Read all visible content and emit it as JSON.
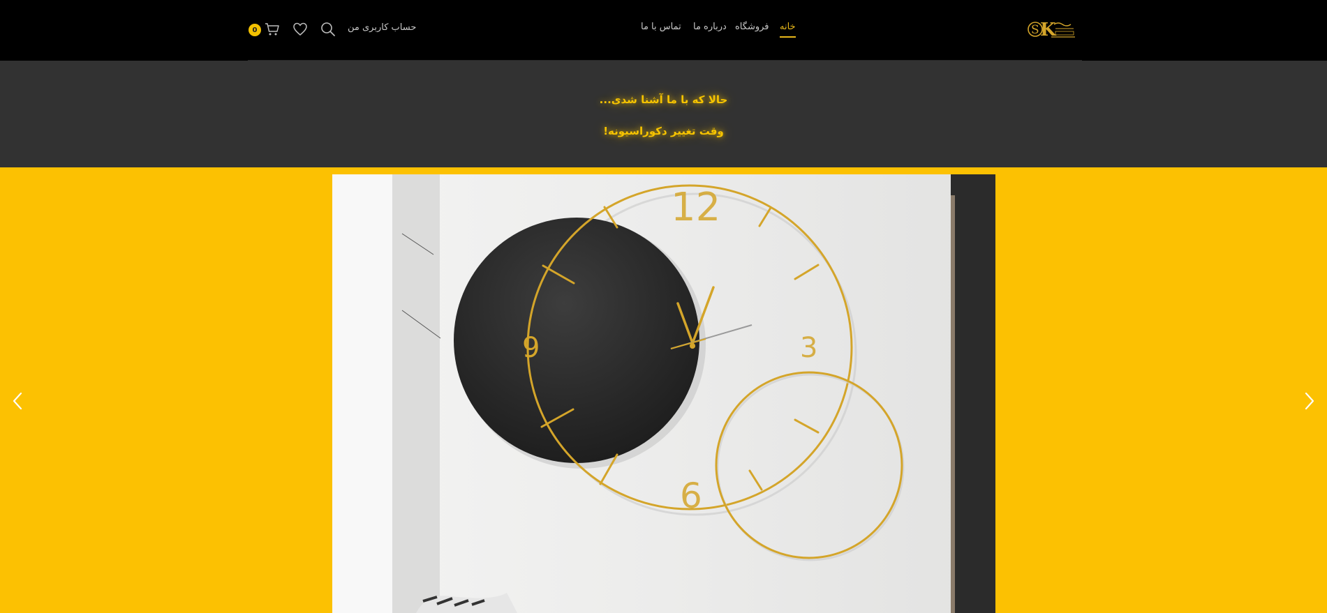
{
  "header": {
    "logo": {
      "monogram": "SK",
      "icon": "logo-icon"
    },
    "nav": [
      {
        "label": "خانه",
        "active": true
      },
      {
        "label": "فروشگاه",
        "active": false
      },
      {
        "label": "درباره ما",
        "active": false
      },
      {
        "label": "تماس با ما",
        "active": false
      }
    ],
    "account_label": "حساب کاربری من",
    "icons": [
      "search-icon",
      "heart-icon",
      "cart-icon"
    ],
    "cart_count": "0"
  },
  "announcement": {
    "line1": "حالا که با ما آشنا شدی...",
    "line2": "وقت تغییر دکوراسیونه!"
  },
  "slider": {
    "slide_image": "wall-clock-photo",
    "prev_icon": "chevron-left-icon",
    "next_icon": "chevron-right-icon"
  },
  "colors": {
    "accent": "#fcc102",
    "header_bg": "#000000",
    "band_bg": "#323232",
    "gold": "#d4a52a"
  }
}
